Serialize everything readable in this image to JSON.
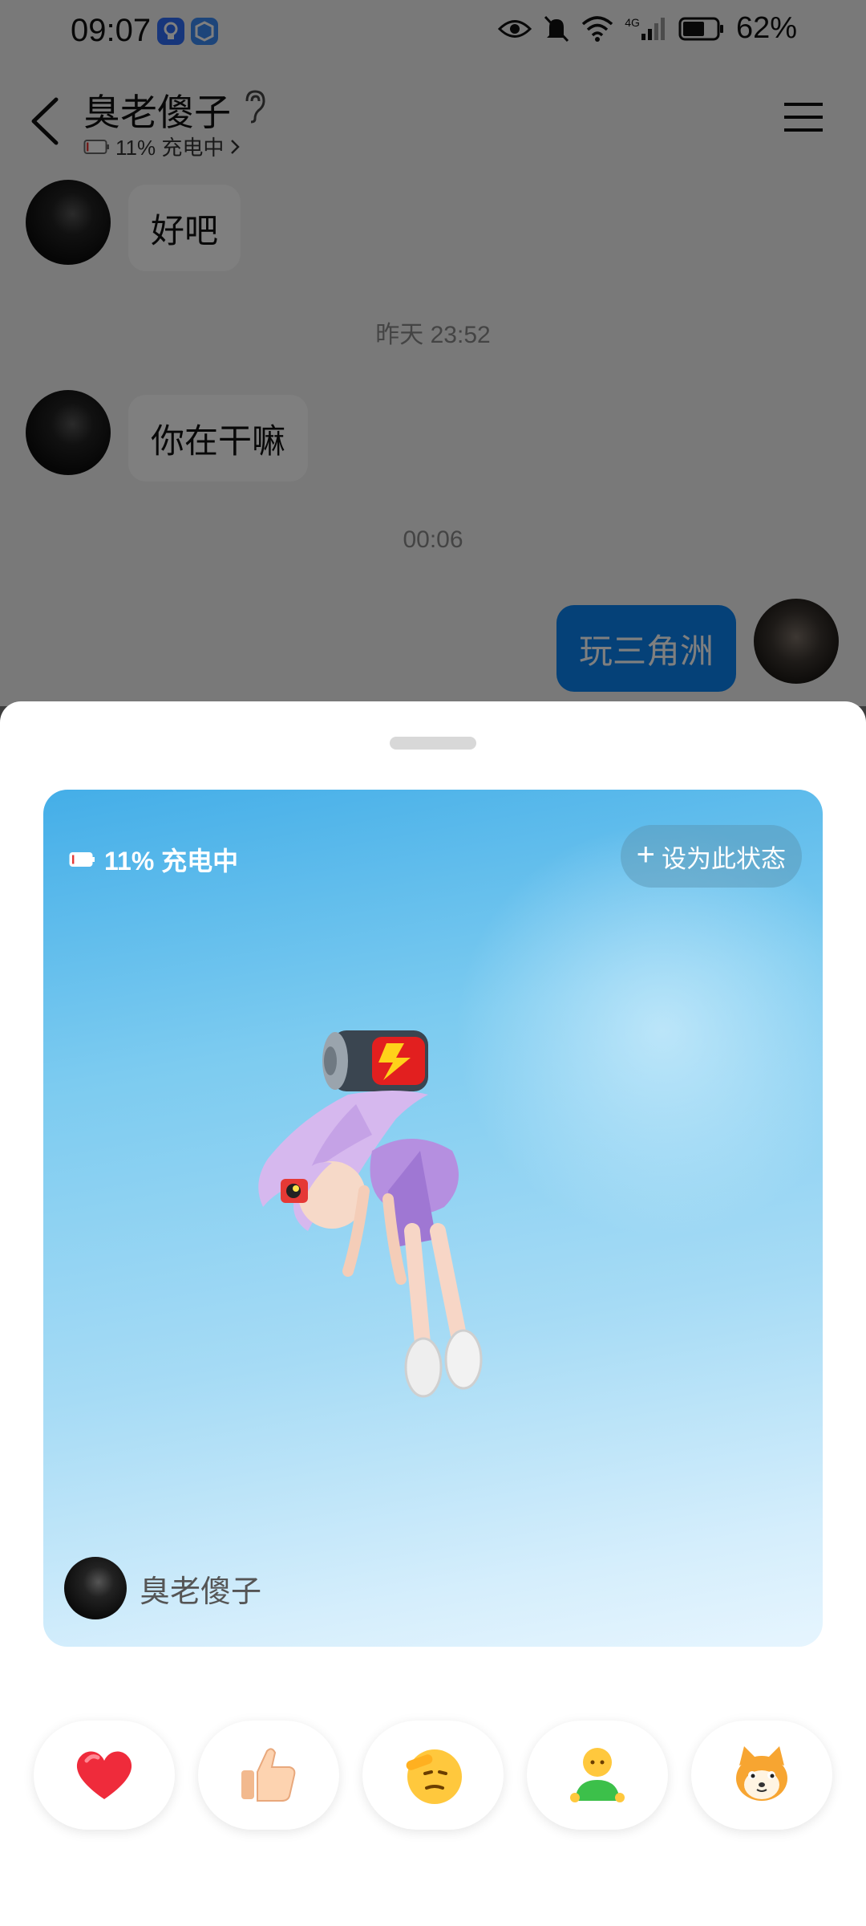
{
  "statusbar": {
    "time": "09:07",
    "network": "4G",
    "battery_pct": "62%"
  },
  "header": {
    "contact_name": "臭老傻子",
    "contact_status": "11% 充电中",
    "status_battery_level": 0.11
  },
  "messages": [
    {
      "type": "received",
      "text": "好吧"
    },
    {
      "type": "time",
      "text": "昨天 23:52"
    },
    {
      "type": "received",
      "text": "你在干嘛"
    },
    {
      "type": "time",
      "text": "00:06"
    },
    {
      "type": "sent",
      "text": "玩三角洲"
    }
  ],
  "status_card": {
    "status_text": "11% 充电中",
    "battery_level": 0.11,
    "set_button_label": "设为此状态",
    "username": "臭老傻子"
  },
  "reactions": [
    {
      "icon": "heart-icon"
    },
    {
      "icon": "thumbs-up-icon"
    },
    {
      "icon": "salute-face-icon"
    },
    {
      "icon": "person-emoji-icon"
    },
    {
      "icon": "shiba-dog-icon"
    }
  ],
  "colors": {
    "accent": "#0A82F0",
    "card_top": "#44AEE8",
    "card_bottom": "#E6F5FE"
  }
}
